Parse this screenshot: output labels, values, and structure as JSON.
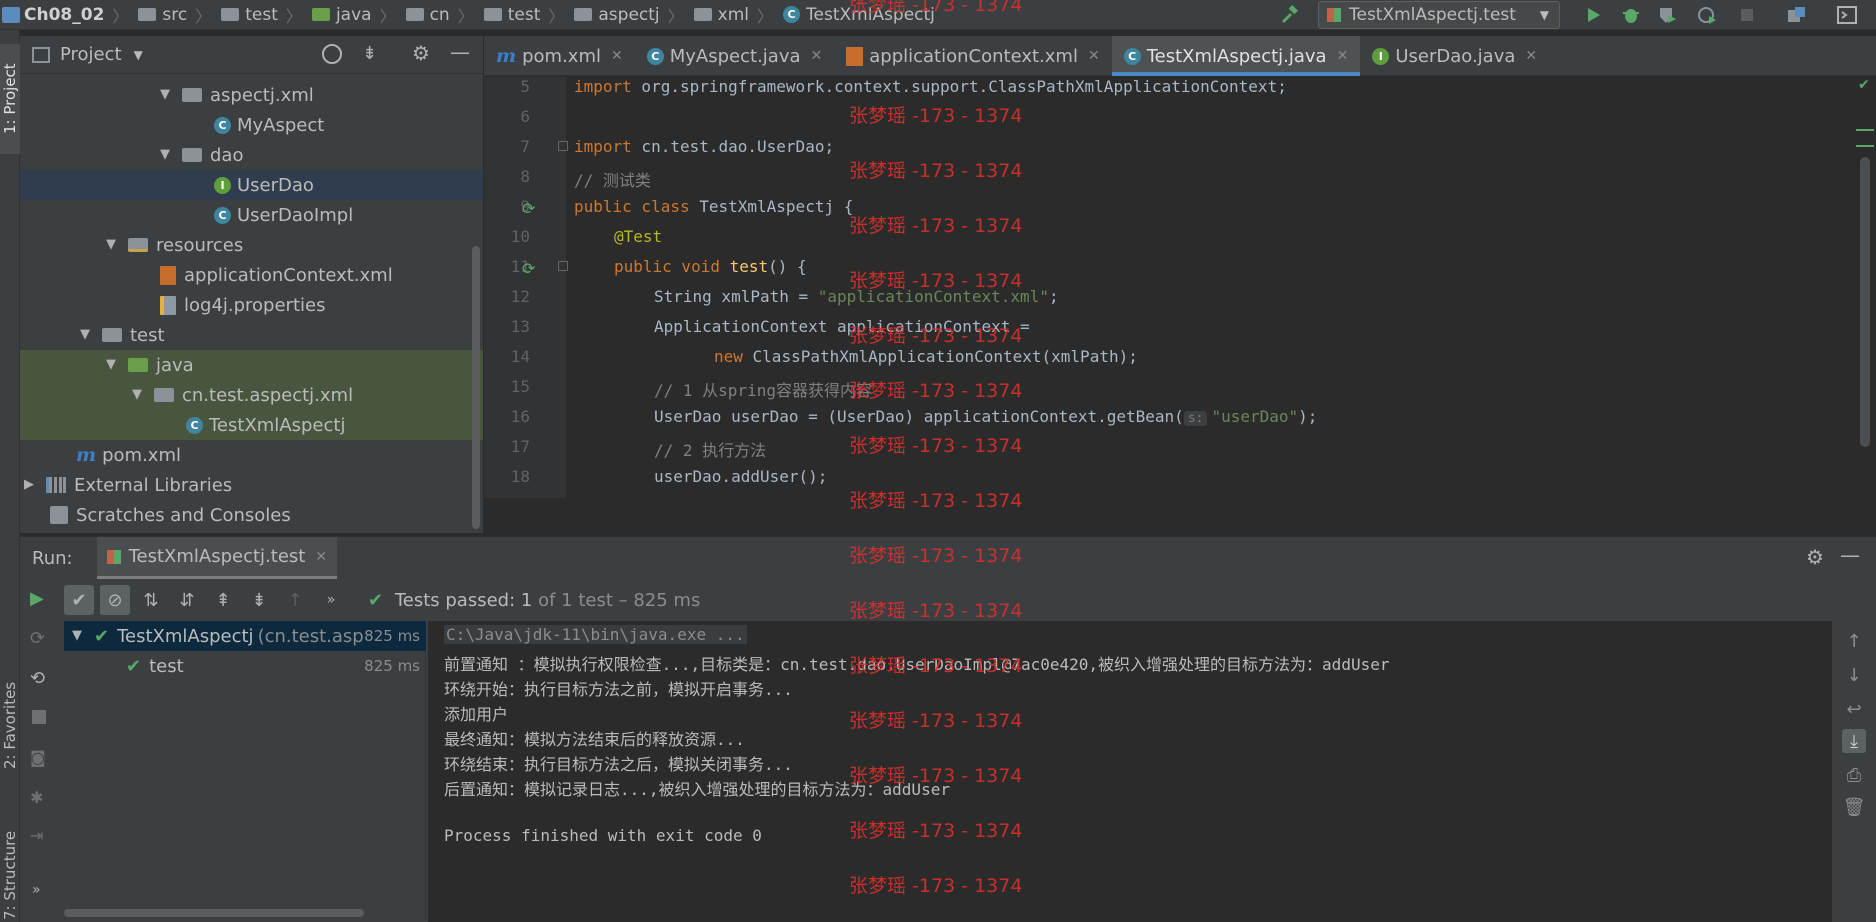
{
  "navbar": {
    "breadcrumbs": [
      "Ch08_02",
      "src",
      "test",
      "java",
      "cn",
      "test",
      "aspectj",
      "xml",
      "TestXmlAspectj"
    ],
    "run_config": "TestXmlAspectj.test"
  },
  "left_strip": {
    "project_tab": "1: Project",
    "favorites_tab": "2: Favorites",
    "structure_tab": "7: Structure"
  },
  "project_panel": {
    "title": "Project",
    "tree": [
      {
        "label": "aspectj.xml"
      },
      {
        "label": "MyAspect"
      },
      {
        "label": "dao"
      },
      {
        "label": "UserDao"
      },
      {
        "label": "UserDaoImpl"
      },
      {
        "label": "resources"
      },
      {
        "label": "applicationContext.xml"
      },
      {
        "label": "log4j.properties"
      },
      {
        "label": "test"
      },
      {
        "label": "java"
      },
      {
        "label": "cn.test.aspectj.xml"
      },
      {
        "label": "TestXmlAspectj"
      },
      {
        "label": "pom.xml"
      },
      {
        "label": "External Libraries"
      },
      {
        "label": "Scratches and Consoles"
      }
    ]
  },
  "editor_tabs": [
    {
      "label": "pom.xml"
    },
    {
      "label": "MyAspect.java"
    },
    {
      "label": "applicationContext.xml"
    },
    {
      "label": "TestXmlAspectj.java"
    },
    {
      "label": "UserDao.java"
    }
  ],
  "editor": {
    "line_numbers": [
      "5",
      "6",
      "7",
      "8",
      "9",
      "10",
      "11",
      "12",
      "13",
      "14",
      "15",
      "16",
      "17",
      "18"
    ],
    "code": {
      "l5_kw": "import",
      "l5_rest": " org.springframework.context.support.ClassPathXmlApplicationContext;",
      "l7_kw": "import",
      "l7_rest": " cn.test.dao.UserDao;",
      "l8": "// 测试类",
      "l9_kw": "public class",
      "l9_rest": " TestXmlAspectj {",
      "l10": "@Test",
      "l11_kw": "public void",
      "l11_fn": " test",
      "l11_rest": "() {",
      "l12_pre": "String xmlPath = ",
      "l12_str": "\"applicationContext.xml\"",
      "l12_post": ";",
      "l13": "ApplicationContext applicationContext =",
      "l14_kw": "new",
      "l14_rest": " ClassPathXmlApplicationContext(xmlPath);",
      "l15": "// 1 从spring容器获得内容",
      "l16_pre": "UserDao userDao = (UserDao) applicationContext.getBean(",
      "l16_hint": "s:",
      "l16_str": "\"userDao\"",
      "l16_post": ");",
      "l17": "// 2 执行方法",
      "l18": "userDao.addUser();"
    }
  },
  "run_panel": {
    "label": "Run:",
    "tab": "TestXmlAspectj.test",
    "status_prefix": "Tests passed:",
    "status_count": "1",
    "status_suffix": "of 1 test – 825 ms",
    "tests": [
      {
        "name": "TestXmlAspectj",
        "detail": "(cn.test.asp",
        "time": "825 ms"
      },
      {
        "name": "test",
        "detail": "",
        "time": "825 ms"
      }
    ],
    "console": [
      "C:\\Java\\jdk-11\\bin\\java.exe ...",
      "前置通知 ：模拟执行权限检查...,目标类是：cn.test.dao.UserDaoImpl@7ac0e420,被织入增强处理的目标方法为：addUser",
      "环绕开始：执行目标方法之前，模拟开启事务...",
      "添加用户",
      "最终通知：模拟方法结束后的释放资源...",
      "环绕结束：执行目标方法之后，模拟关闭事务...",
      "后置通知：模拟记录日志...,被织入增强处理的目标方法为：addUser",
      "",
      "Process finished with exit code 0"
    ]
  },
  "watermark": "张梦瑶 -173 - 1374",
  "colors": {
    "accent_blue": "#4a88c7",
    "pass_green": "#59a869",
    "watermark_red": "#d9302c"
  }
}
